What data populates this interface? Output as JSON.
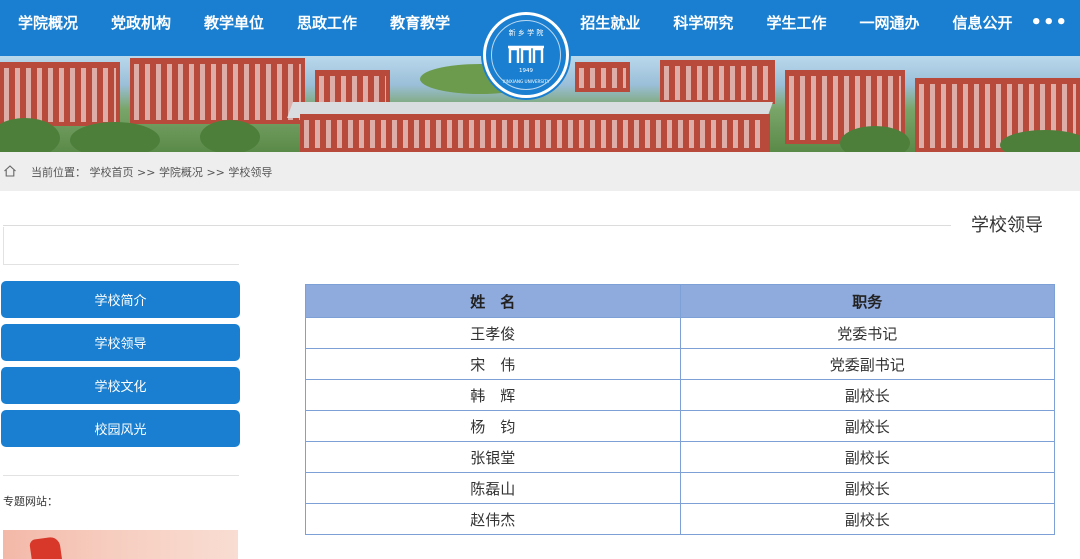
{
  "nav": {
    "left": [
      "学院概况",
      "党政机构",
      "教学单位",
      "思政工作",
      "教育教学"
    ],
    "right": [
      "招生就业",
      "科学研究",
      "学生工作",
      "一网通办",
      "信息公开"
    ],
    "more_icon": "ellipsis-icon"
  },
  "logo": {
    "top_text": "新 乡 学 院",
    "bottom_text": "XINXIANG UNIVERSITY",
    "year": "1949"
  },
  "breadcrumb": {
    "icon": "home-icon",
    "prefix": "当前位置：",
    "items": [
      "学校首页",
      "学院概况",
      "学校领导"
    ],
    "separator": " >> "
  },
  "page_title": "学校领导",
  "sidebar": {
    "items": [
      "学校简介",
      "学校领导",
      "学校文化",
      "校园风光"
    ],
    "special_label": "专题网站："
  },
  "table": {
    "headers": [
      "姓　名",
      "职务"
    ],
    "rows": [
      [
        "王孝俊",
        "党委书记"
      ],
      [
        "宋　伟",
        "党委副书记"
      ],
      [
        "韩　辉",
        "副校长"
      ],
      [
        "杨　钧",
        "副校长"
      ],
      [
        "张银堂",
        "副校长"
      ],
      [
        "陈磊山",
        "副校长"
      ],
      [
        "赵伟杰",
        "副校长"
      ]
    ]
  },
  "colors": {
    "primary": "#1a7fd0",
    "table_header": "#8faadc",
    "table_border": "#7da0d6",
    "crumb_bg": "#eeeeee"
  }
}
